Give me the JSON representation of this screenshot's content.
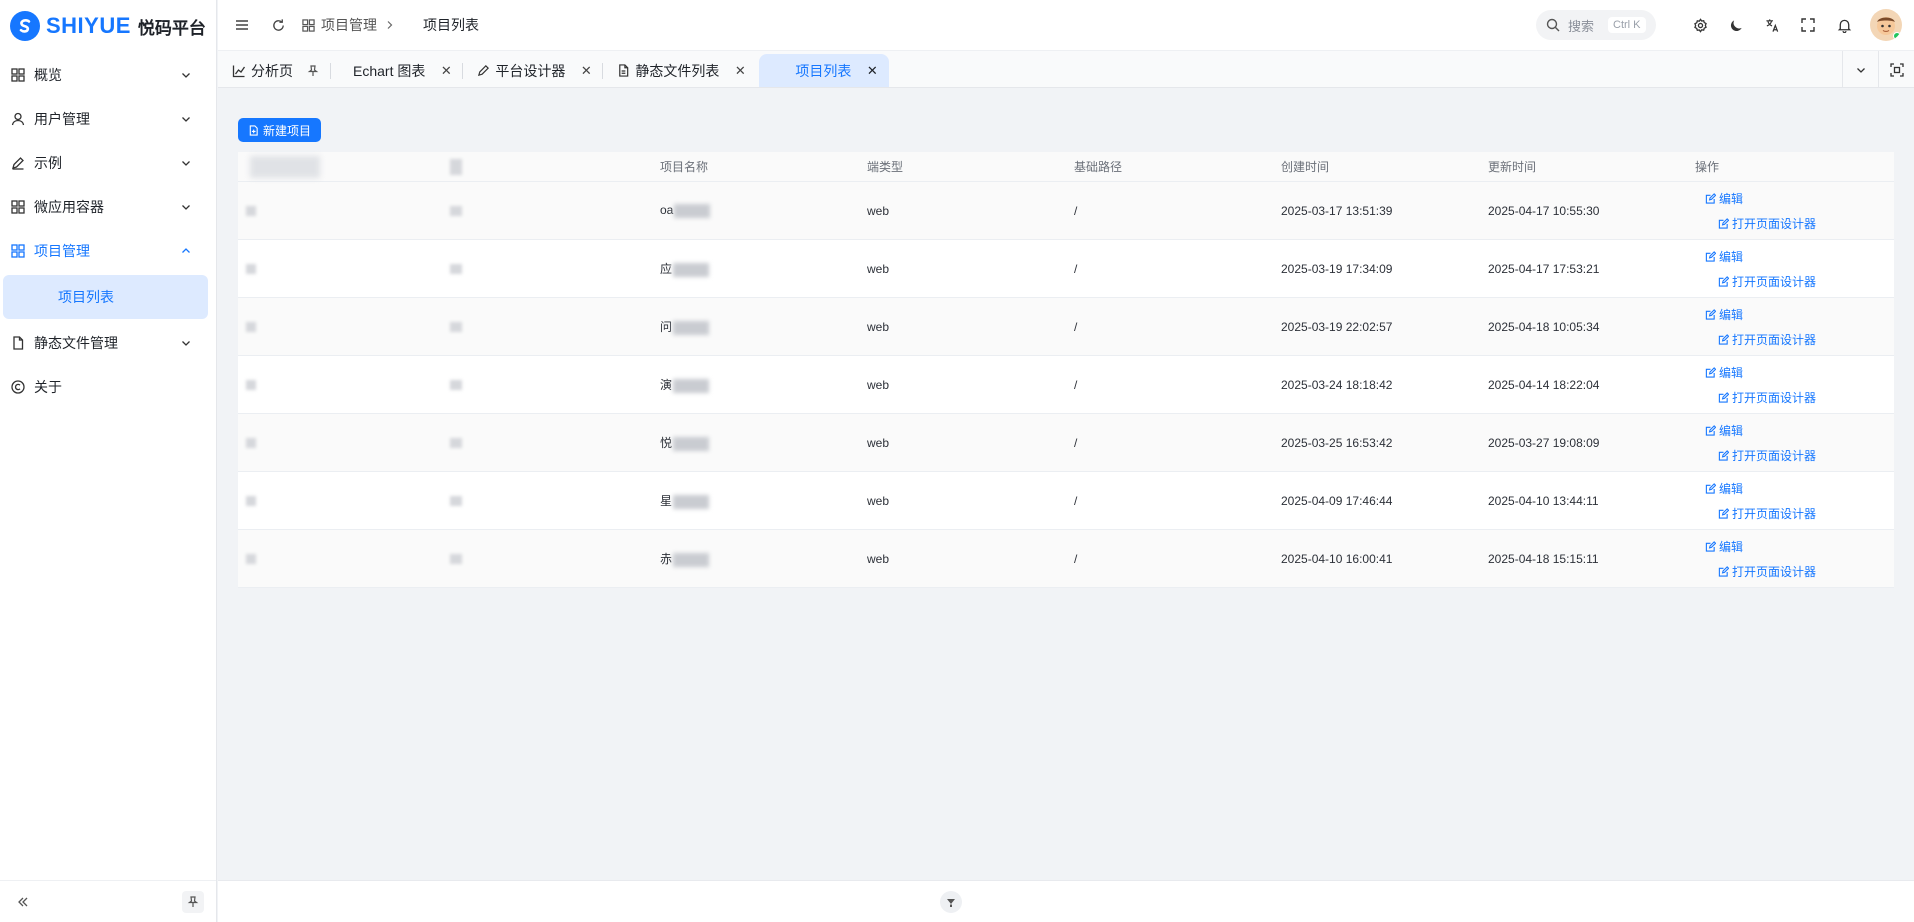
{
  "app": {
    "brand": "SHIYUE",
    "title": "悦码平台"
  },
  "sidebar": {
    "items": [
      {
        "label": "概览",
        "icon": "dashboard-icon",
        "expanded": false
      },
      {
        "label": "用户管理",
        "icon": "user-icon",
        "expanded": false
      },
      {
        "label": "示例",
        "icon": "pen-icon",
        "expanded": false
      },
      {
        "label": "微应用容器",
        "icon": "grid-icon",
        "expanded": false
      },
      {
        "label": "项目管理",
        "icon": "grid-icon",
        "expanded": true
      },
      {
        "label": "静态文件管理",
        "icon": "file-icon",
        "expanded": false
      },
      {
        "label": "关于",
        "icon": "copyright-icon",
        "expanded": false
      }
    ],
    "sub_items": [
      {
        "label": "项目列表",
        "active": true
      }
    ]
  },
  "header": {
    "breadcrumb": [
      "项目管理",
      "项目列表"
    ],
    "search_placeholder": "搜索",
    "search_shortcut": "Ctrl K"
  },
  "tabs": [
    {
      "label": "分析页",
      "icon": "chart-icon",
      "pinned": true
    },
    {
      "label": "Echart 图表",
      "icon": "",
      "closable": true
    },
    {
      "label": "平台设计器",
      "icon": "pen-icon",
      "closable": true
    },
    {
      "label": "静态文件列表",
      "icon": "file-icon",
      "closable": true
    },
    {
      "label": "项目列表",
      "icon": "",
      "closable": true,
      "active": true
    }
  ],
  "main": {
    "new_button": "新建项目",
    "table": {
      "headers": [
        "",
        "项目名称",
        "端类型",
        "基础路径",
        "创建时间",
        "更新时间",
        "操作"
      ],
      "rows": [
        {
          "name": "oa",
          "type": "web",
          "path": "/",
          "created": "2025-03-17 13:51:39",
          "updated": "2025-04-17 10:55:30"
        },
        {
          "name": "应",
          "type": "web",
          "path": "/",
          "created": "2025-03-19 17:34:09",
          "updated": "2025-04-17 17:53:21"
        },
        {
          "name": "问",
          "type": "web",
          "path": "/",
          "created": "2025-03-19 22:02:57",
          "updated": "2025-04-18 10:05:34"
        },
        {
          "name": "演",
          "type": "web",
          "path": "/",
          "created": "2025-03-24 18:18:42",
          "updated": "2025-04-14 18:22:04"
        },
        {
          "name": "悦",
          "type": "web",
          "path": "/",
          "created": "2025-03-25 16:53:42",
          "updated": "2025-03-27 19:08:09"
        },
        {
          "name": "星",
          "type": "web",
          "path": "/",
          "created": "2025-04-09 17:46:44",
          "updated": "2025-04-10 13:44:11"
        },
        {
          "name": "赤",
          "type": "web",
          "path": "/",
          "created": "2025-04-10 16:00:41",
          "updated": "2025-04-18 15:15:11"
        }
      ],
      "op_edit": "编辑",
      "op_designer": "打开页面设计器"
    }
  },
  "colors": {
    "accent": "#1677ff",
    "active_bg": "#ddeaff"
  }
}
